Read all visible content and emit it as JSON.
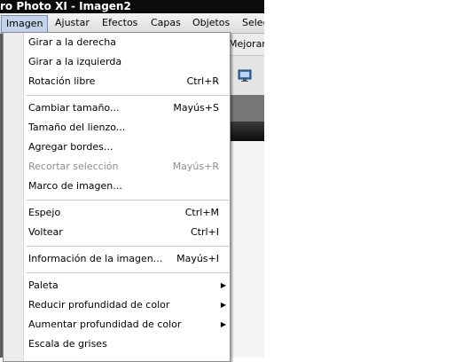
{
  "window": {
    "title": "ro Photo XI - Imagen2"
  },
  "menubar": {
    "items": [
      {
        "label": "Imagen",
        "active": true
      },
      {
        "label": "Ajustar"
      },
      {
        "label": "Efectos"
      },
      {
        "label": "Capas"
      },
      {
        "label": "Objetos"
      },
      {
        "label": "Selec"
      }
    ]
  },
  "toolbar": {
    "partial_label": "Mejorar f"
  },
  "menu": {
    "items": [
      {
        "label": "Girar a la derecha",
        "shortcut": ""
      },
      {
        "label": "Girar a la izquierda",
        "shortcut": ""
      },
      {
        "label": "Rotación libre",
        "shortcut": "Ctrl+R"
      },
      {
        "label": "Cambiar tamaño...",
        "shortcut": "Mayús+S"
      },
      {
        "label": "Tamaño del lienzo...",
        "shortcut": ""
      },
      {
        "label": "Agregar bordes...",
        "shortcut": ""
      },
      {
        "label": "Recortar selección",
        "shortcut": "Mayús+R",
        "disabled": true
      },
      {
        "label": "Marco de imagen...",
        "shortcut": ""
      },
      {
        "label": "Espejo",
        "shortcut": "Ctrl+M"
      },
      {
        "label": "Voltear",
        "shortcut": "Ctrl+I"
      },
      {
        "label": "Información de la imagen...",
        "shortcut": "Mayús+I"
      },
      {
        "label": "Paleta",
        "shortcut": "",
        "submenu": true
      },
      {
        "label": "Reducir profundidad de color",
        "shortcut": "",
        "submenu": true
      },
      {
        "label": "Aumentar profundidad de color",
        "shortcut": "",
        "submenu": true
      },
      {
        "label": "Escala de grises",
        "shortcut": ""
      }
    ]
  },
  "icons": {
    "toolbar_icon": "monitor-icon",
    "submenu_arrow": "▶"
  }
}
